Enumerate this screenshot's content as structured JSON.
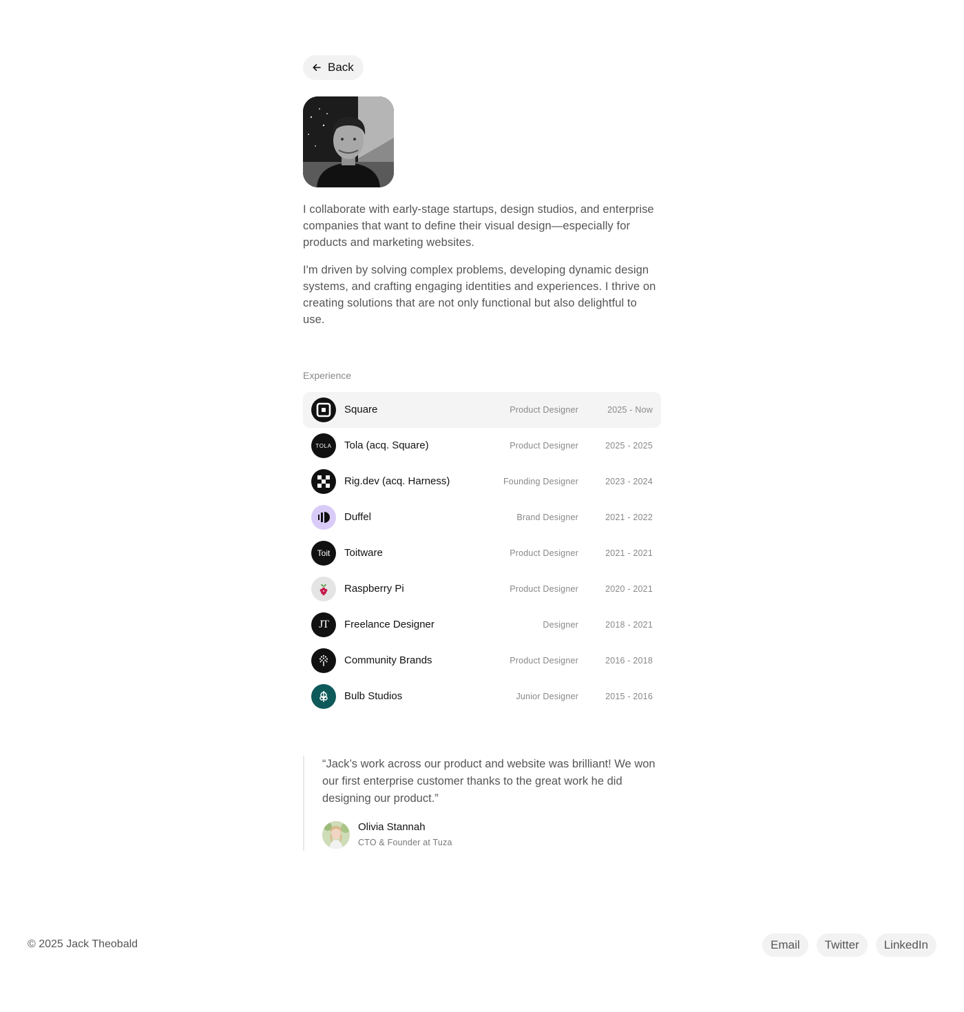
{
  "nav": {
    "back_label": "Back"
  },
  "profile": {
    "bio_1": "I collaborate with early-stage startups, design studios, and enterprise companies that want to define their visual design—especially for products and marketing websites.",
    "bio_2": "I'm driven by solving complex problems, developing dynamic design systems, and crafting engaging identities and experiences. I thrive on creating solutions that are not only functional but also delightful to use."
  },
  "experience": {
    "label": "Experience",
    "items": [
      {
        "company": "Square",
        "role": "Product Designer",
        "dates": "2025 - Now",
        "logo": "square-logo-icon",
        "logo_bg": "#111111"
      },
      {
        "company": "Tola (acq. Square)",
        "role": "Product Designer",
        "dates": "2025 - 2025",
        "logo": "tola-logo-icon",
        "logo_text": "TOLA",
        "logo_bg": "#111111"
      },
      {
        "company": "Rig.dev (acq. Harness)",
        "role": "Founding Designer",
        "dates": "2023 - 2024",
        "logo": "rigdev-logo-icon",
        "logo_bg": "#111111"
      },
      {
        "company": "Duffel",
        "role": "Brand Designer",
        "dates": "2021 - 2022",
        "logo": "duffel-logo-icon",
        "logo_bg": "#d9cbf7"
      },
      {
        "company": "Toitware",
        "role": "Product Designer",
        "dates": "2021 - 2021",
        "logo": "toitware-logo-icon",
        "logo_text": "Toit",
        "logo_bg": "#111111"
      },
      {
        "company": "Raspberry Pi",
        "role": "Product Designer",
        "dates": "2020 - 2021",
        "logo": "raspberry-pi-logo-icon",
        "logo_bg": "#e4e4e4"
      },
      {
        "company": "Freelance Designer",
        "role": "Designer",
        "dates": "2018 - 2021",
        "logo": "jt-monogram-icon",
        "logo_text": "JT",
        "logo_bg": "#111111"
      },
      {
        "company": "Community Brands",
        "role": "Product Designer",
        "dates": "2016 - 2018",
        "logo": "community-brands-tree-icon",
        "logo_bg": "#111111"
      },
      {
        "company": "Bulb Studios",
        "role": "Junior Designer",
        "dates": "2015 - 2016",
        "logo": "bulb-studios-logo-icon",
        "logo_bg": "#0e5a5a"
      }
    ]
  },
  "testimonial": {
    "quote": "“Jack’s work across our product and website was brilliant! We won our first enterprise customer thanks to the great work he did designing our product.”",
    "name": "Olivia Stannah",
    "role": "CTO & Founder at Tuza"
  },
  "footer": {
    "copyright": "© 2025 Jack Theobald",
    "links": [
      "Email",
      "Twitter",
      "LinkedIn"
    ]
  }
}
